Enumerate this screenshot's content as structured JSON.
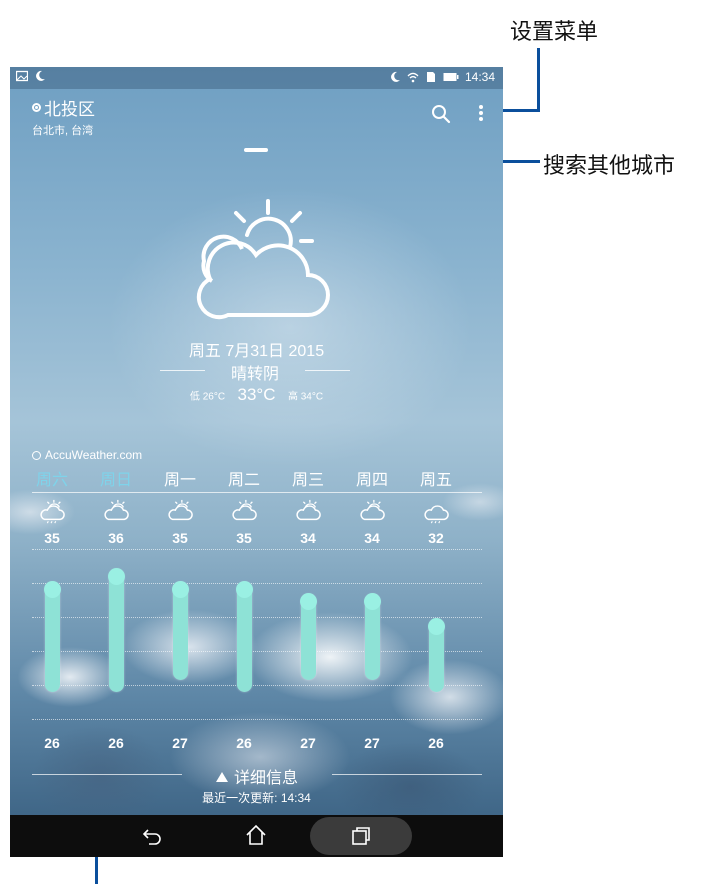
{
  "annotations": {
    "settings_menu": "设置菜单",
    "search_cities": "搜索其他城市"
  },
  "status_bar": {
    "time": "14:34",
    "left_icons": [
      "image-icon",
      "moon-icon"
    ],
    "right_icons": [
      "moon-icon",
      "wifi-icon",
      "sim-icon",
      "battery-icon"
    ]
  },
  "location": {
    "name": "北投区",
    "region": "台北市, 台湾"
  },
  "current": {
    "date": "周五 7月31日 2015",
    "condition": "晴转阴",
    "low_label": "低 26°C",
    "temp": "33°C",
    "high_label": "高 34°C",
    "icon": "partly-cloudy-sun-icon"
  },
  "provider": "AccuWeather.com",
  "forecast": {
    "days": [
      {
        "label": "周六",
        "high": "35",
        "low": "26",
        "weekend": true,
        "icon": "sun-cloud-rain-icon"
      },
      {
        "label": "周日",
        "high": "36",
        "low": "26",
        "weekend": true,
        "icon": "sun-cloud-icon"
      },
      {
        "label": "周一",
        "high": "35",
        "low": "27",
        "weekend": false,
        "icon": "sun-cloud-icon"
      },
      {
        "label": "周二",
        "high": "35",
        "low": "26",
        "weekend": false,
        "icon": "sun-cloud-icon"
      },
      {
        "label": "周三",
        "high": "34",
        "low": "27",
        "weekend": false,
        "icon": "sun-cloud-icon"
      },
      {
        "label": "周四",
        "high": "34",
        "low": "27",
        "weekend": false,
        "icon": "sun-cloud-icon"
      },
      {
        "label": "周五",
        "high": "32",
        "low": "26",
        "weekend": false,
        "icon": "cloud-rain-icon"
      }
    ]
  },
  "footer": {
    "details": "详细信息",
    "updated_label": "最近一次更新:",
    "updated_time": "14:34"
  },
  "colors": {
    "accent_weekend": "#7fd3ea",
    "bar": "#8ee2d6",
    "callout": "#0b4f9c"
  }
}
